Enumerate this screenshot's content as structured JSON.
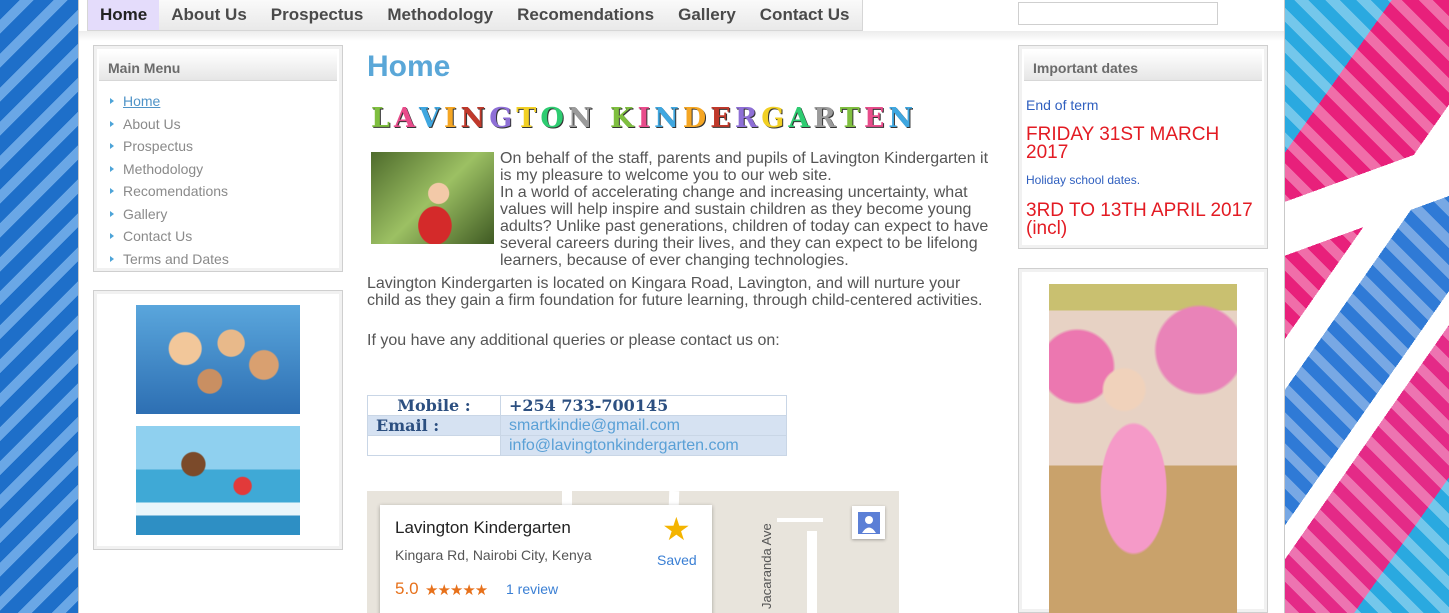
{
  "nav": {
    "items": [
      "Home",
      "About Us",
      "Prospectus",
      "Methodology",
      "Recomendations",
      "Gallery",
      "Contact Us"
    ],
    "active": "Home"
  },
  "main_menu": {
    "title": "Main Menu",
    "items": [
      "Home",
      "About Us",
      "Prospectus",
      "Methodology",
      "Recomendations",
      "Gallery",
      "Contact Us",
      "Terms and Dates"
    ]
  },
  "page": {
    "title": "Home",
    "banner": "LAVINGTON KINDERGARTEN",
    "paragraph1": "On behalf of the staff, parents and pupils of  Lavington Kindergarten it is my pleasure to welcome you to our web site.",
    "paragraph1b": "In a world of accelerating change and increasing uncertainty, what values will help inspire and sustain children as they become young adults? Unlike past generations, children of today can expect to have several careers during their lives, and they can expect to be lifelong learners, because of ever changing technologies.",
    "paragraph2": "Lavington Kindergarten is located on  Kingara Road, Lavington, and will nurture your child as they gain a firm foundation for future learning, through child-centered activities.",
    "paragraph3": "If you have any additional queries or please contact us on:"
  },
  "contact": {
    "mobile_label": "Mobile :",
    "mobile_value": "+254 733-700145",
    "email_label": "Email :",
    "email1": "smartkindie@gmail.com",
    "email2": "info@lavingtonkindergarten.com"
  },
  "map": {
    "place_name": "Lavington Kindergarten",
    "address": "Kingara Rd, Nairobi City, Kenya",
    "rating": "5.0",
    "stars": "★★★★★",
    "review": "1 review",
    "saved": "Saved",
    "street": "Jacaranda Ave"
  },
  "important_dates": {
    "title": "Important dates",
    "end_of_term_label": "End of term",
    "end_of_term_date": "FRIDAY 31ST MARCH 2017",
    "holiday_label": "Holiday school dates.",
    "holiday_dates": "3RD TO 13TH APRIL 2017 (incl)"
  },
  "colors": {
    "accent": "#5aa7d8",
    "red": "#e31b23",
    "link": "#2f5fbf"
  }
}
